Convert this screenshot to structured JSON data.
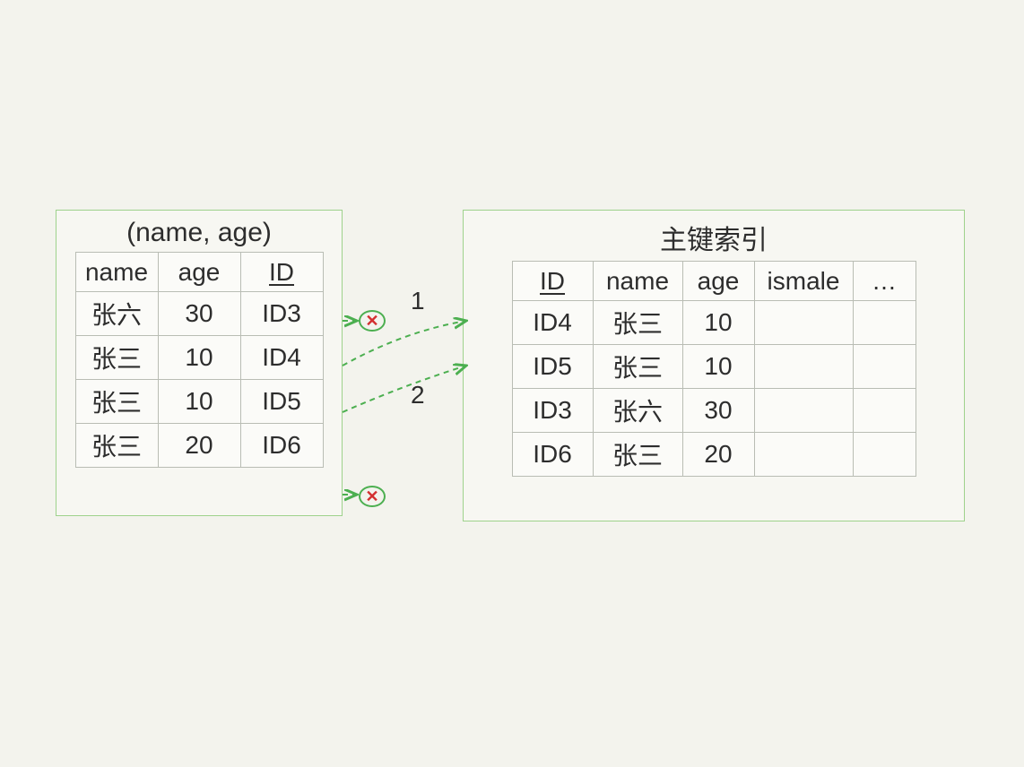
{
  "left": {
    "title": "(name, age)",
    "headers": {
      "name": "name",
      "age": "age",
      "id": "ID"
    },
    "rows": [
      {
        "name": "张六",
        "age": "30",
        "id": "ID3"
      },
      {
        "name": "张三",
        "age": "10",
        "id": "ID4"
      },
      {
        "name": "张三",
        "age": "10",
        "id": "ID5"
      },
      {
        "name": "张三",
        "age": "20",
        "id": "ID6"
      }
    ]
  },
  "right": {
    "title": "主键索引",
    "headers": {
      "id": "ID",
      "name": "name",
      "age": "age",
      "ismale": "ismale",
      "more": "…"
    },
    "rows": [
      {
        "id": "ID4",
        "name": "张三",
        "age": "10",
        "ismale": "",
        "more": ""
      },
      {
        "id": "ID5",
        "name": "张三",
        "age": "10",
        "ismale": "",
        "more": ""
      },
      {
        "id": "ID3",
        "name": "张六",
        "age": "30",
        "ismale": "",
        "more": ""
      },
      {
        "id": "ID6",
        "name": "张三",
        "age": "20",
        "ismale": "",
        "more": ""
      }
    ]
  },
  "annotations": {
    "cross1": "✕",
    "cross2": "✕",
    "label1": "1",
    "label2": "2"
  }
}
